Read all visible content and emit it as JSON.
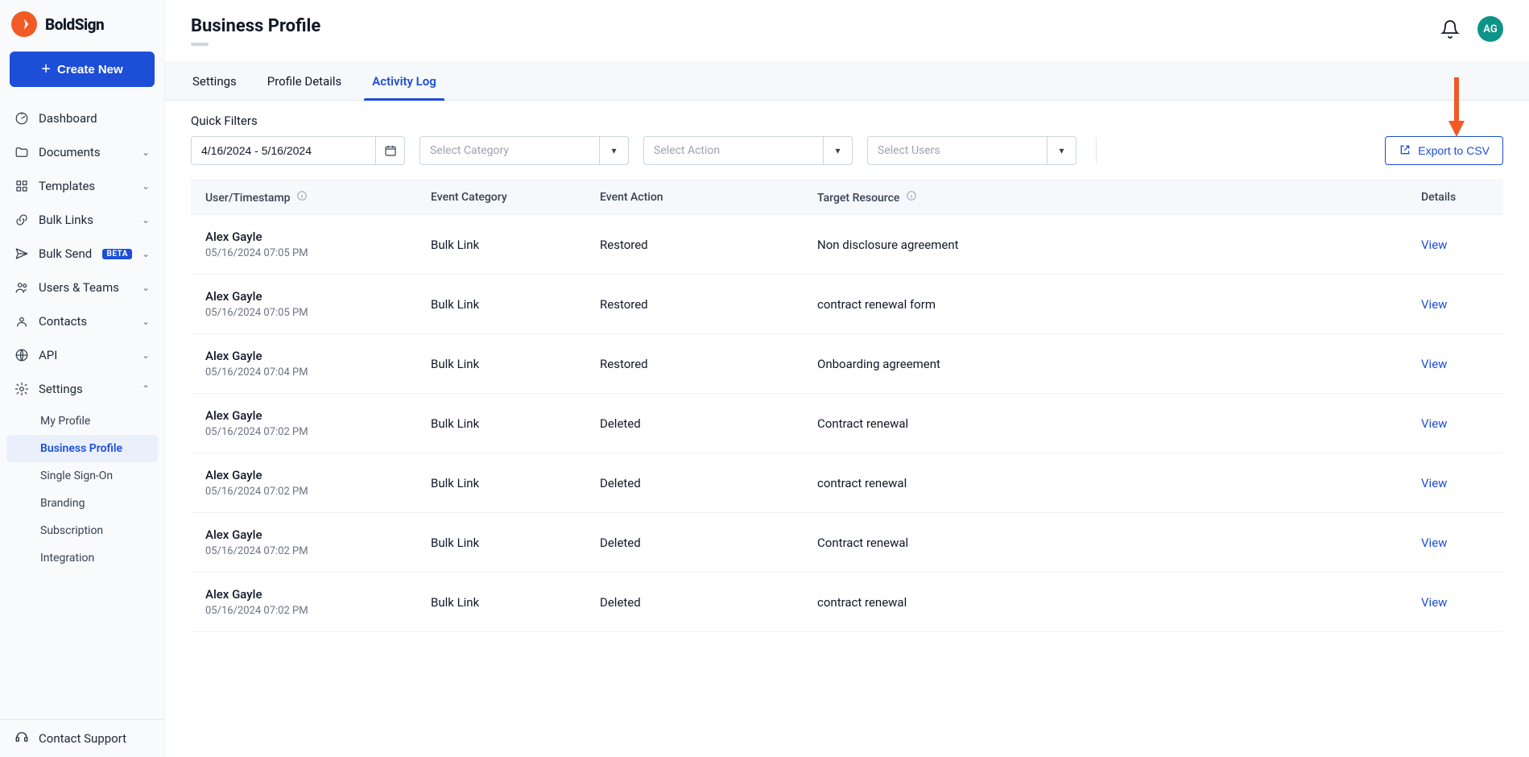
{
  "brand": {
    "name": "BoldSign"
  },
  "sidebar": {
    "create_label": "Create New",
    "items": [
      {
        "label": "Dashboard",
        "icon": "gauge",
        "expandable": false
      },
      {
        "label": "Documents",
        "icon": "folder",
        "expandable": true
      },
      {
        "label": "Templates",
        "icon": "grid",
        "expandable": true
      },
      {
        "label": "Bulk Links",
        "icon": "link",
        "expandable": true
      },
      {
        "label": "Bulk Send",
        "icon": "send",
        "expandable": true,
        "beta": true
      },
      {
        "label": "Users & Teams",
        "icon": "users",
        "expandable": true
      },
      {
        "label": "Contacts",
        "icon": "contact",
        "expandable": true
      },
      {
        "label": "API",
        "icon": "api",
        "expandable": true
      },
      {
        "label": "Settings",
        "icon": "gear",
        "expandable": true,
        "expanded": true
      }
    ],
    "settings_sub": [
      {
        "label": "My Profile",
        "active": false
      },
      {
        "label": "Business Profile",
        "active": true
      },
      {
        "label": "Single Sign-On",
        "active": false
      },
      {
        "label": "Branding",
        "active": false
      },
      {
        "label": "Subscription",
        "active": false
      },
      {
        "label": "Integration",
        "active": false
      }
    ],
    "support_label": "Contact Support"
  },
  "header": {
    "title": "Business Profile",
    "avatar_initials": "AG"
  },
  "tabs": [
    {
      "label": "Settings",
      "active": false
    },
    {
      "label": "Profile Details",
      "active": false
    },
    {
      "label": "Activity Log",
      "active": true
    }
  ],
  "filters": {
    "label": "Quick Filters",
    "date_range": "4/16/2024 - 5/16/2024",
    "category_placeholder": "Select Category",
    "action_placeholder": "Select Action",
    "users_placeholder": "Select Users",
    "export_label": "Export to CSV"
  },
  "table": {
    "columns": {
      "user": "User/Timestamp",
      "category": "Event Category",
      "action": "Event Action",
      "resource": "Target Resource",
      "details": "Details"
    },
    "view_label": "View",
    "rows": [
      {
        "user": "Alex Gayle",
        "ts": "05/16/2024 07:05 PM",
        "category": "Bulk Link",
        "action": "Restored",
        "resource": "Non disclosure agreement"
      },
      {
        "user": "Alex Gayle",
        "ts": "05/16/2024 07:05 PM",
        "category": "Bulk Link",
        "action": "Restored",
        "resource": "contract renewal form"
      },
      {
        "user": "Alex Gayle",
        "ts": "05/16/2024 07:04 PM",
        "category": "Bulk Link",
        "action": "Restored",
        "resource": "Onboarding agreement"
      },
      {
        "user": "Alex Gayle",
        "ts": "05/16/2024 07:02 PM",
        "category": "Bulk Link",
        "action": "Deleted",
        "resource": "Contract renewal"
      },
      {
        "user": "Alex Gayle",
        "ts": "05/16/2024 07:02 PM",
        "category": "Bulk Link",
        "action": "Deleted",
        "resource": "contract renewal"
      },
      {
        "user": "Alex Gayle",
        "ts": "05/16/2024 07:02 PM",
        "category": "Bulk Link",
        "action": "Deleted",
        "resource": "Contract renewal"
      },
      {
        "user": "Alex Gayle",
        "ts": "05/16/2024 07:02 PM",
        "category": "Bulk Link",
        "action": "Deleted",
        "resource": "contract renewal"
      }
    ]
  },
  "beta_label": "BETA"
}
